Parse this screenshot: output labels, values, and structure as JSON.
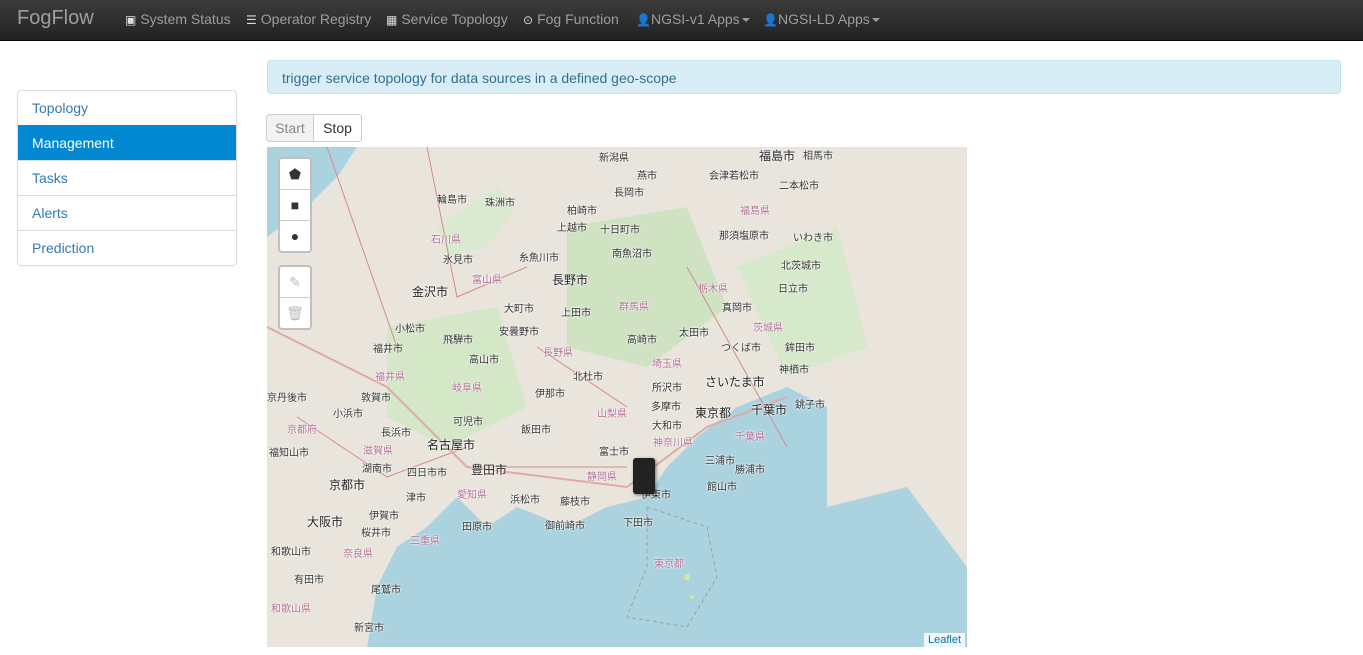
{
  "navbar": {
    "brand": "FogFlow",
    "items": [
      {
        "label": "System Status",
        "icon": "picture-icon"
      },
      {
        "label": "Operator Registry",
        "icon": "list-icon"
      },
      {
        "label": "Service Topology",
        "icon": "grid-icon"
      },
      {
        "label": "Fog Function",
        "icon": "target-icon"
      },
      {
        "label": "NGSI-v1 Apps",
        "icon": "user-icon"
      },
      {
        "label": "NGSI-LD Apps",
        "icon": "user-icon"
      }
    ]
  },
  "sidebar": {
    "items": [
      {
        "label": "Topology"
      },
      {
        "label": "Management"
      },
      {
        "label": "Tasks"
      },
      {
        "label": "Alerts"
      },
      {
        "label": "Prediction"
      }
    ]
  },
  "info": "trigger service topology for data sources in a defined geo-scope",
  "controls": {
    "start": "Start",
    "stop": "Stop"
  },
  "map": {
    "attribution": "Leaflet",
    "tools": [
      "polygon-icon",
      "rectangle-icon",
      "circle-icon",
      "edit-icon",
      "trash-icon"
    ],
    "labels": [
      {
        "text": "新潟県"
      },
      {
        "text": "燕市"
      },
      {
        "text": "福島市"
      },
      {
        "text": "相馬市"
      },
      {
        "text": "長岡市"
      },
      {
        "text": "会津若松市"
      },
      {
        "text": "二本松市"
      },
      {
        "text": "輪島市"
      },
      {
        "text": "珠洲市"
      },
      {
        "text": "柏崎市"
      },
      {
        "text": "上越市"
      },
      {
        "text": "十日町市"
      },
      {
        "text": "福島県"
      },
      {
        "text": "石川県"
      },
      {
        "text": "那須塩原市"
      },
      {
        "text": "いわき市"
      },
      {
        "text": "氷見市"
      },
      {
        "text": "糸魚川市"
      },
      {
        "text": "南魚沼市"
      },
      {
        "text": "富山県"
      },
      {
        "text": "北茨城市"
      },
      {
        "text": "長野市"
      },
      {
        "text": "金沢市"
      },
      {
        "text": "大町市"
      },
      {
        "text": "栃木県"
      },
      {
        "text": "日立市"
      },
      {
        "text": "群馬県"
      },
      {
        "text": "真岡市"
      },
      {
        "text": "上田市"
      },
      {
        "text": "小松市"
      },
      {
        "text": "飛騨市"
      },
      {
        "text": "安曇野市"
      },
      {
        "text": "太田市"
      },
      {
        "text": "茨城県"
      },
      {
        "text": "高崎市"
      },
      {
        "text": "つくば市"
      },
      {
        "text": "鉾田市"
      },
      {
        "text": "福井市"
      },
      {
        "text": "長野県"
      },
      {
        "text": "高山市"
      },
      {
        "text": "埼玉県"
      },
      {
        "text": "神栖市"
      },
      {
        "text": "北杜市"
      },
      {
        "text": "福井県"
      },
      {
        "text": "さいたま市"
      },
      {
        "text": "岐阜県"
      },
      {
        "text": "伊那市"
      },
      {
        "text": "所沢市"
      },
      {
        "text": "京丹後市"
      },
      {
        "text": "敦賀市"
      },
      {
        "text": "千葉市"
      },
      {
        "text": "銚子市"
      },
      {
        "text": "小浜市"
      },
      {
        "text": "多摩市"
      },
      {
        "text": "山梨県"
      },
      {
        "text": "東京都"
      },
      {
        "text": "可児市"
      },
      {
        "text": "大和市"
      },
      {
        "text": "京都府"
      },
      {
        "text": "長浜市"
      },
      {
        "text": "飯田市"
      },
      {
        "text": "神奈川県"
      },
      {
        "text": "千葉県"
      },
      {
        "text": "滋賀県"
      },
      {
        "text": "名古屋市"
      },
      {
        "text": "富士市"
      },
      {
        "text": "福知山市"
      },
      {
        "text": "湖南市"
      },
      {
        "text": "四日市市"
      },
      {
        "text": "豊田市"
      },
      {
        "text": "静岡県"
      },
      {
        "text": "三浦市"
      },
      {
        "text": "勝浦市"
      },
      {
        "text": "京都市"
      },
      {
        "text": "館山市"
      },
      {
        "text": "津市"
      },
      {
        "text": "愛知県"
      },
      {
        "text": "浜松市"
      },
      {
        "text": "藤枝市"
      },
      {
        "text": "伊東市"
      },
      {
        "text": "大阪市"
      },
      {
        "text": "伊賀市"
      },
      {
        "text": "田原市"
      },
      {
        "text": "御前崎市"
      },
      {
        "text": "下田市"
      },
      {
        "text": "桜井市"
      },
      {
        "text": "三重県"
      },
      {
        "text": "東京都"
      },
      {
        "text": "和歌山市"
      },
      {
        "text": "奈良県"
      },
      {
        "text": "有田市"
      },
      {
        "text": "尾鷲市"
      },
      {
        "text": "和歌山県"
      },
      {
        "text": "新宮市"
      }
    ]
  }
}
